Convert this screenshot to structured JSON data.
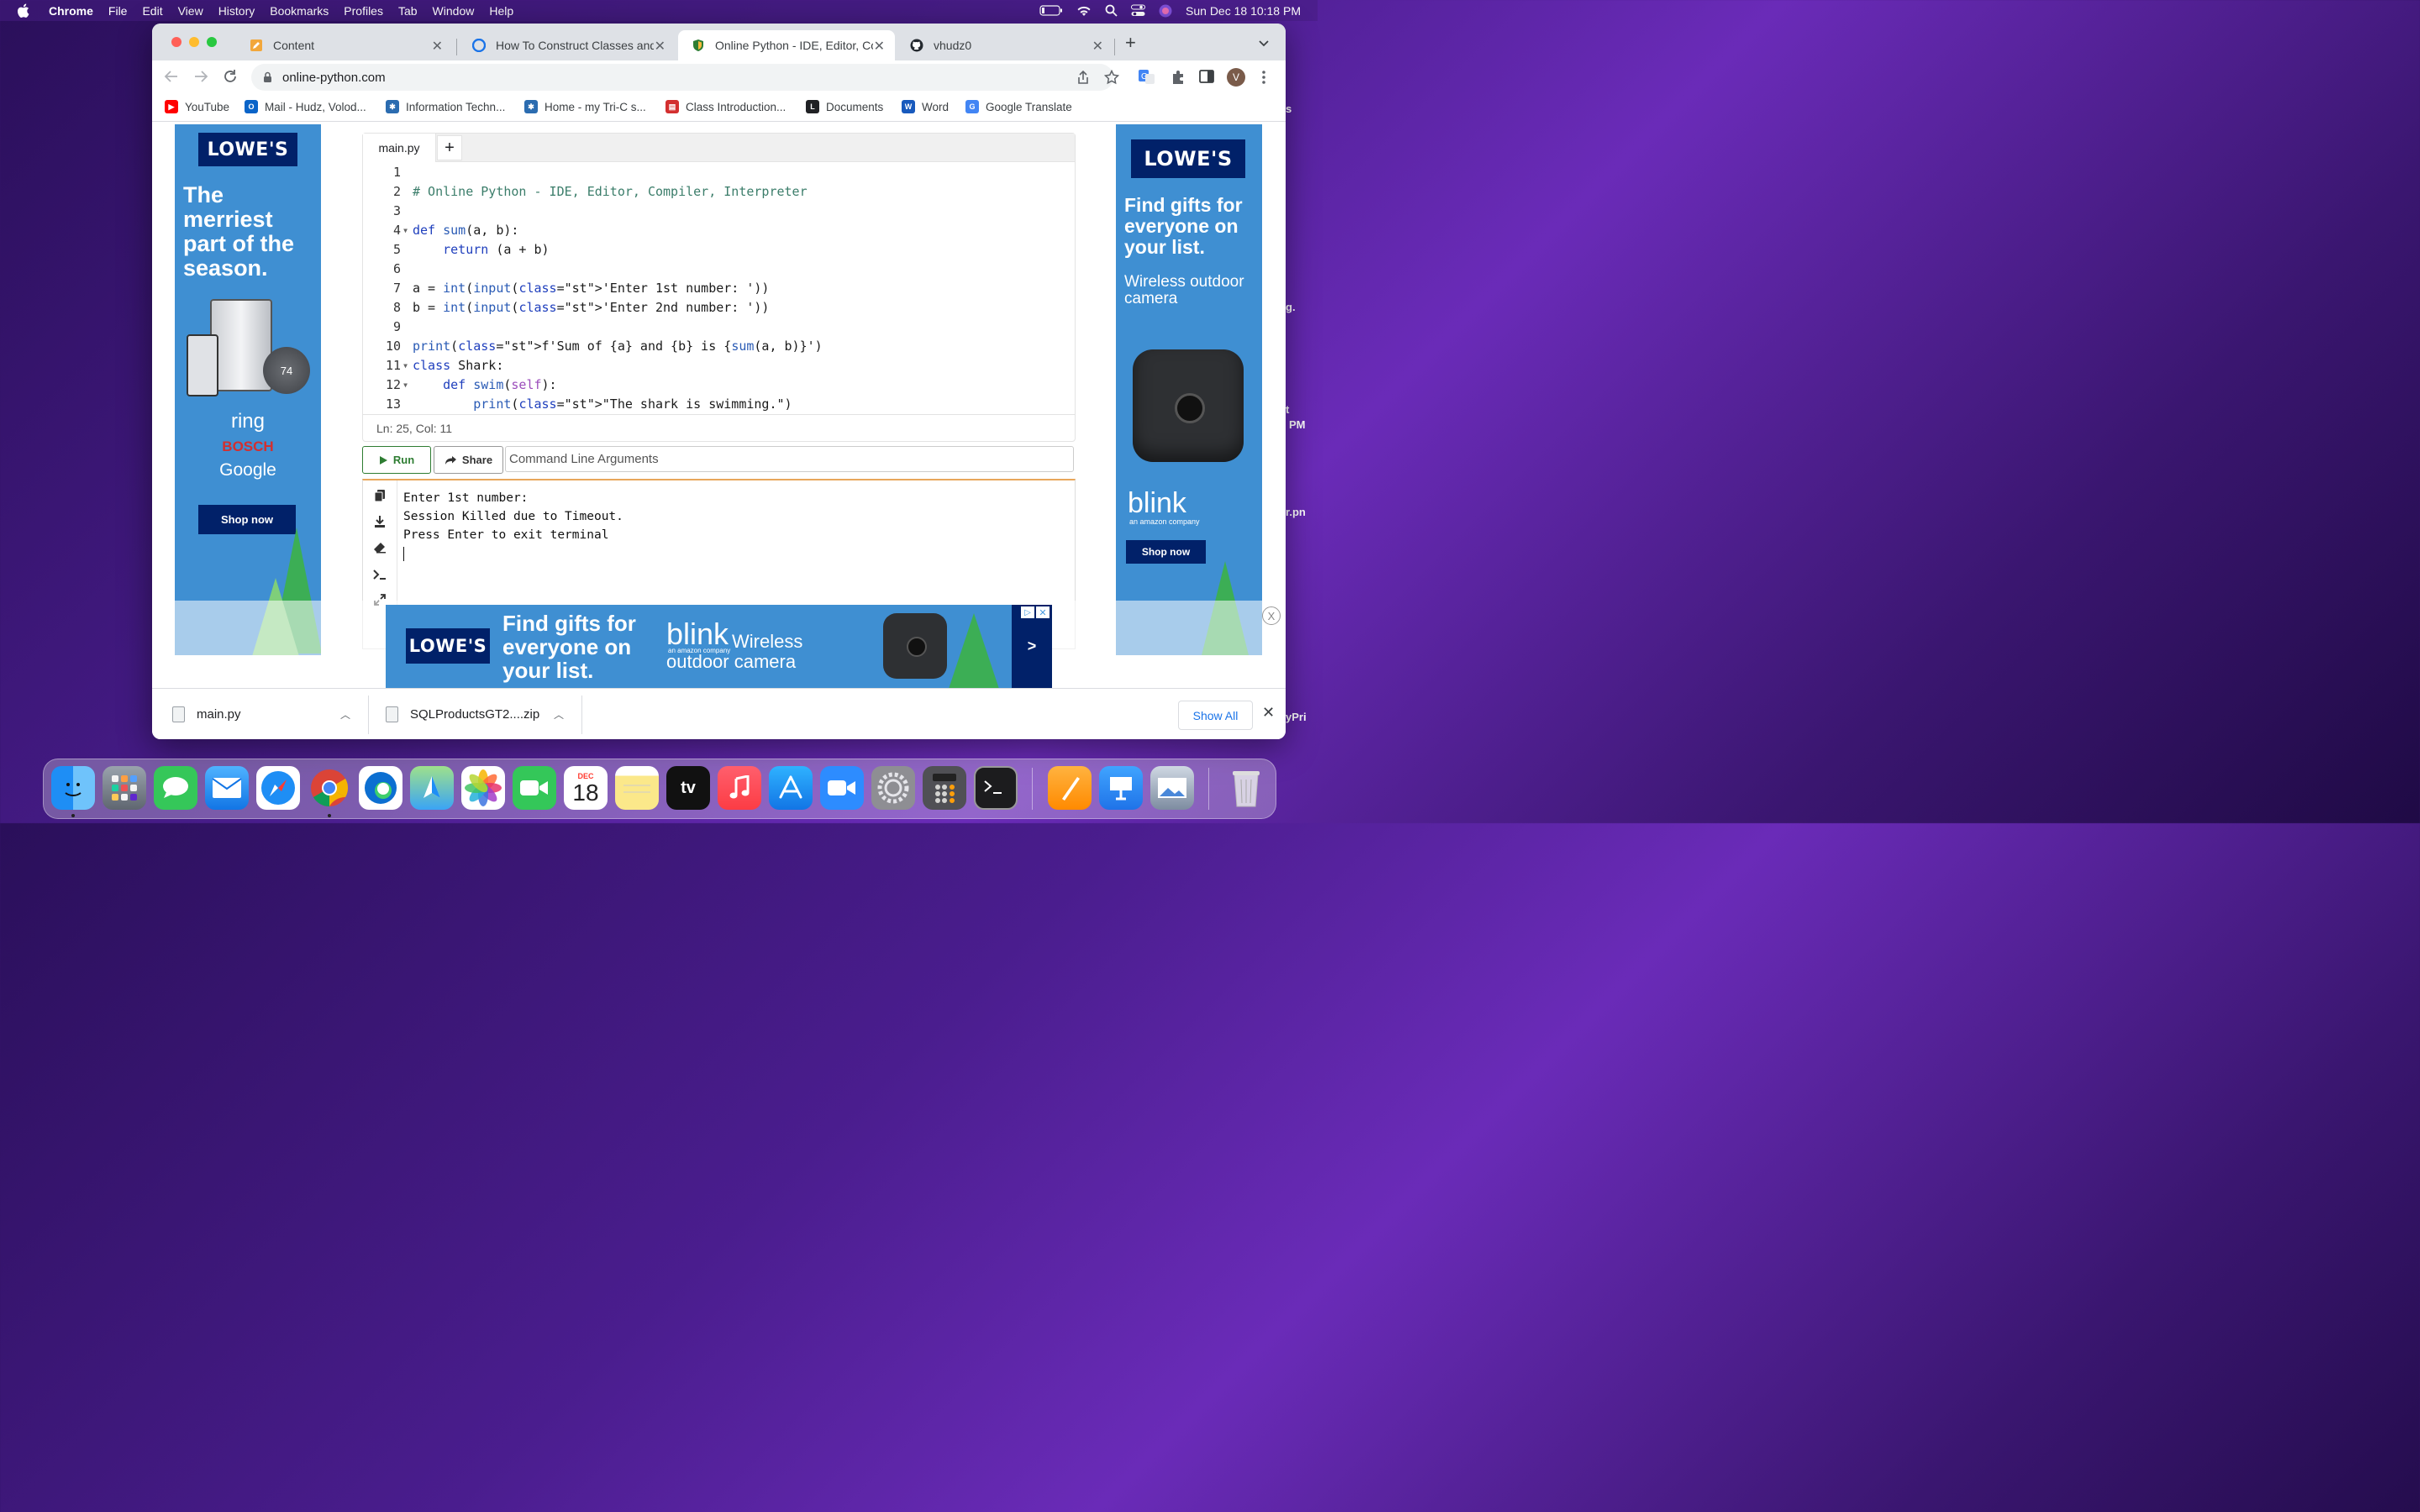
{
  "menubar": {
    "app": "Chrome",
    "items": [
      "File",
      "Edit",
      "View",
      "History",
      "Bookmarks",
      "Profiles",
      "Tab",
      "Window",
      "Help"
    ],
    "datetime": "Sun Dec 18  10:18 PM"
  },
  "tabs": [
    {
      "title": "Content"
    },
    {
      "title": "How To Construct Classes and"
    },
    {
      "title": "Online Python - IDE, Editor, Co"
    },
    {
      "title": "vhudz0"
    }
  ],
  "address": {
    "url": "online-python.com"
  },
  "profile": {
    "initial": "V"
  },
  "bookmarks": [
    {
      "label": "YouTube"
    },
    {
      "label": "Mail - Hudz, Volod..."
    },
    {
      "label": "Information Techn..."
    },
    {
      "label": "Home - my Tri-C s..."
    },
    {
      "label": "Class Introduction..."
    },
    {
      "label": "Documents"
    },
    {
      "label": "Word"
    },
    {
      "label": "Google Translate"
    }
  ],
  "editor": {
    "file_tab": "main.py",
    "add_tab": "+",
    "line_numbers": [
      "1",
      "2",
      "3",
      "4",
      "5",
      "6",
      "7",
      "8",
      "9",
      "10",
      "11",
      "12",
      "13"
    ],
    "lines": [
      "",
      "# Online Python - IDE, Editor, Compiler, Interpreter",
      "",
      "def sum(a, b):",
      "    return (a + b)",
      "",
      "a = int(input('Enter 1st number: '))",
      "b = int(input('Enter 2nd number: '))",
      "",
      "print(f'Sum of {a} and {b} is {sum(a, b)}')",
      "class Shark:",
      "    def swim(self):",
      "        print(\"The shark is swimming.\")"
    ],
    "status": "Ln: 25,  Col: 11"
  },
  "actions": {
    "run": "Run",
    "share": "Share",
    "args_placeholder": "Command Line Arguments"
  },
  "terminal": {
    "lines": [
      "Enter 1st number: ",
      "",
      "Session Killed due to Timeout.",
      "Press Enter to exit terminal"
    ]
  },
  "ads": {
    "left": {
      "brand": "LOWE'S",
      "headline": "The merriest part of the season.",
      "brands": [
        "ring",
        "BOSCH",
        "Google"
      ],
      "cta": "Shop now",
      "thermo": "74"
    },
    "right": {
      "brand": "LOWE'S",
      "headline": "Find gifts for everyone on your list.",
      "sub": "Wireless outdoor camera",
      "blink": "blink",
      "blink_sub": "an amazon company",
      "cta": "Shop now"
    },
    "bottom": {
      "brand": "LOWE'S",
      "headline": "Find gifts for everyone on your list.",
      "blink": "blink",
      "blink_sub": "an amazon company",
      "sub": "Wireless outdoor camera",
      "arrow": ">"
    },
    "close": "X"
  },
  "downloads": {
    "items": [
      {
        "name": "main.py"
      },
      {
        "name": "SQLProductsGT2....zip"
      }
    ],
    "show_all": "Show All"
  },
  "dock": {
    "calendar_month": "DEC",
    "calendar_day": "18",
    "tv_label": "tv"
  },
  "desktop_fragments": [
    "s",
    "g.",
    "t",
    "PM",
    "r.pn",
    "yPri"
  ],
  "colors": {
    "ad_blue": "#3f8fd2",
    "lowes_navy": "#012169",
    "run_green": "#2e7d32",
    "accent_link": "#1a73e8"
  }
}
